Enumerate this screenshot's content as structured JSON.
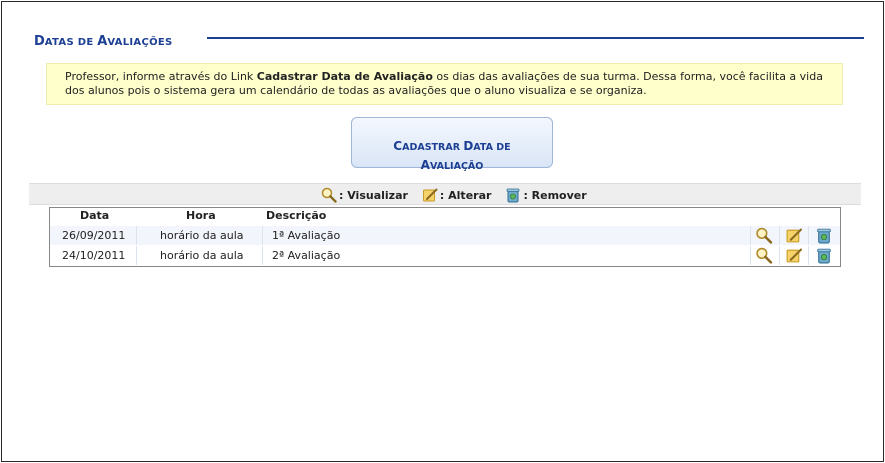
{
  "page": {
    "title_first_big": "D",
    "title_first_small": "ATAS DE ",
    "title_second_big": "A",
    "title_second_small": "VALIAÇÕES"
  },
  "notice": {
    "text_before": "Professor, informe através do Link ",
    "link_text": "Cadastrar Data de Avaliação",
    "text_after": " os dias das avaliações de sua turma. Dessa forma, você facilita a vida dos alunos pois o sistema gera um calendário de todas as avaliações que o aluno visualiza e se organiza."
  },
  "register_button": {
    "line1_big": "C",
    "line1_small": "ADASTRAR ",
    "line1_big2": "D",
    "line1_small2": "ATA DE",
    "line2_big": "A",
    "line2_small": "VALIAÇÃO"
  },
  "legend": {
    "view_label": ": Visualizar",
    "edit_label": ": Alterar",
    "remove_label": ": Remover"
  },
  "table": {
    "headers": {
      "date": "Data",
      "time": "Hora",
      "description": "Descrição"
    },
    "rows": [
      {
        "date": "26/09/2011",
        "time": "horário da aula",
        "description": "1ª Avaliação"
      },
      {
        "date": "24/10/2011",
        "time": "horário da aula",
        "description": "2ª Avaliação"
      }
    ]
  },
  "colors": {
    "title_blue": "#1c3f94",
    "notice_bg": "#ffffcc",
    "row_alt_bg": "#f2f5fc"
  }
}
